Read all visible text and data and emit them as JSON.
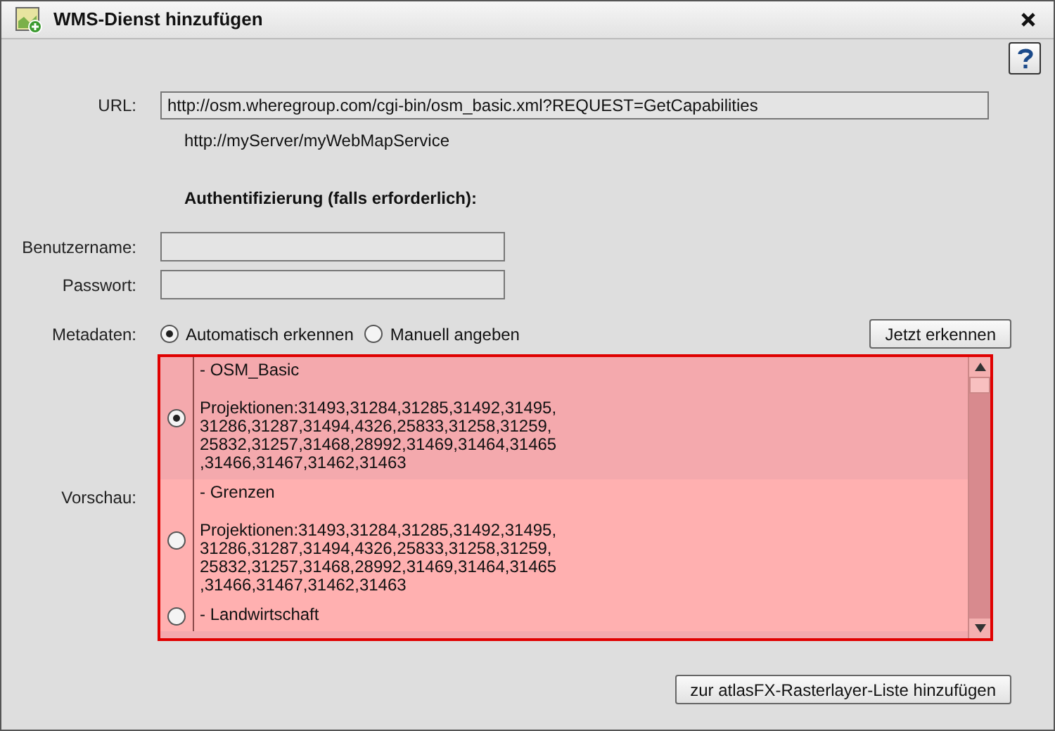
{
  "window": {
    "title": "WMS-Dienst hinzufügen"
  },
  "url": {
    "label": "URL:",
    "value": "http://osm.wheregroup.com/cgi-bin/osm_basic.xml?REQUEST=GetCapabilities",
    "hint": "http://myServer/myWebMapService"
  },
  "auth": {
    "heading": "Authentifizierung (falls erforderlich):",
    "username_label": "Benutzername:",
    "password_label": "Passwort:"
  },
  "metadata": {
    "label": "Metadaten:",
    "options": [
      {
        "label": "Automatisch erkennen",
        "selected": true
      },
      {
        "label": "Manuell angeben",
        "selected": false
      }
    ],
    "button": "Jetzt erkennen"
  },
  "preview": {
    "label": "Vorschau:",
    "items": [
      {
        "title": "- OSM_Basic",
        "projections": "Projektionen:31493,31284,31285,31492,31495,\n31286,31287,31494,4326,25833,31258,31259,\n25832,31257,31468,28992,31469,31464,31465\n,31466,31467,31462,31463",
        "selected": true
      },
      {
        "title": "- Grenzen",
        "projections": "Projektionen:31493,31284,31285,31492,31495,\n31286,31287,31494,4326,25833,31258,31259,\n25832,31257,31468,28992,31469,31464,31465\n,31466,31467,31462,31463",
        "selected": false
      },
      {
        "title": "- Landwirtschaft",
        "selected": false
      }
    ]
  },
  "add_button": "zur atlasFX-Rasterlayer-Liste hinzufügen"
}
